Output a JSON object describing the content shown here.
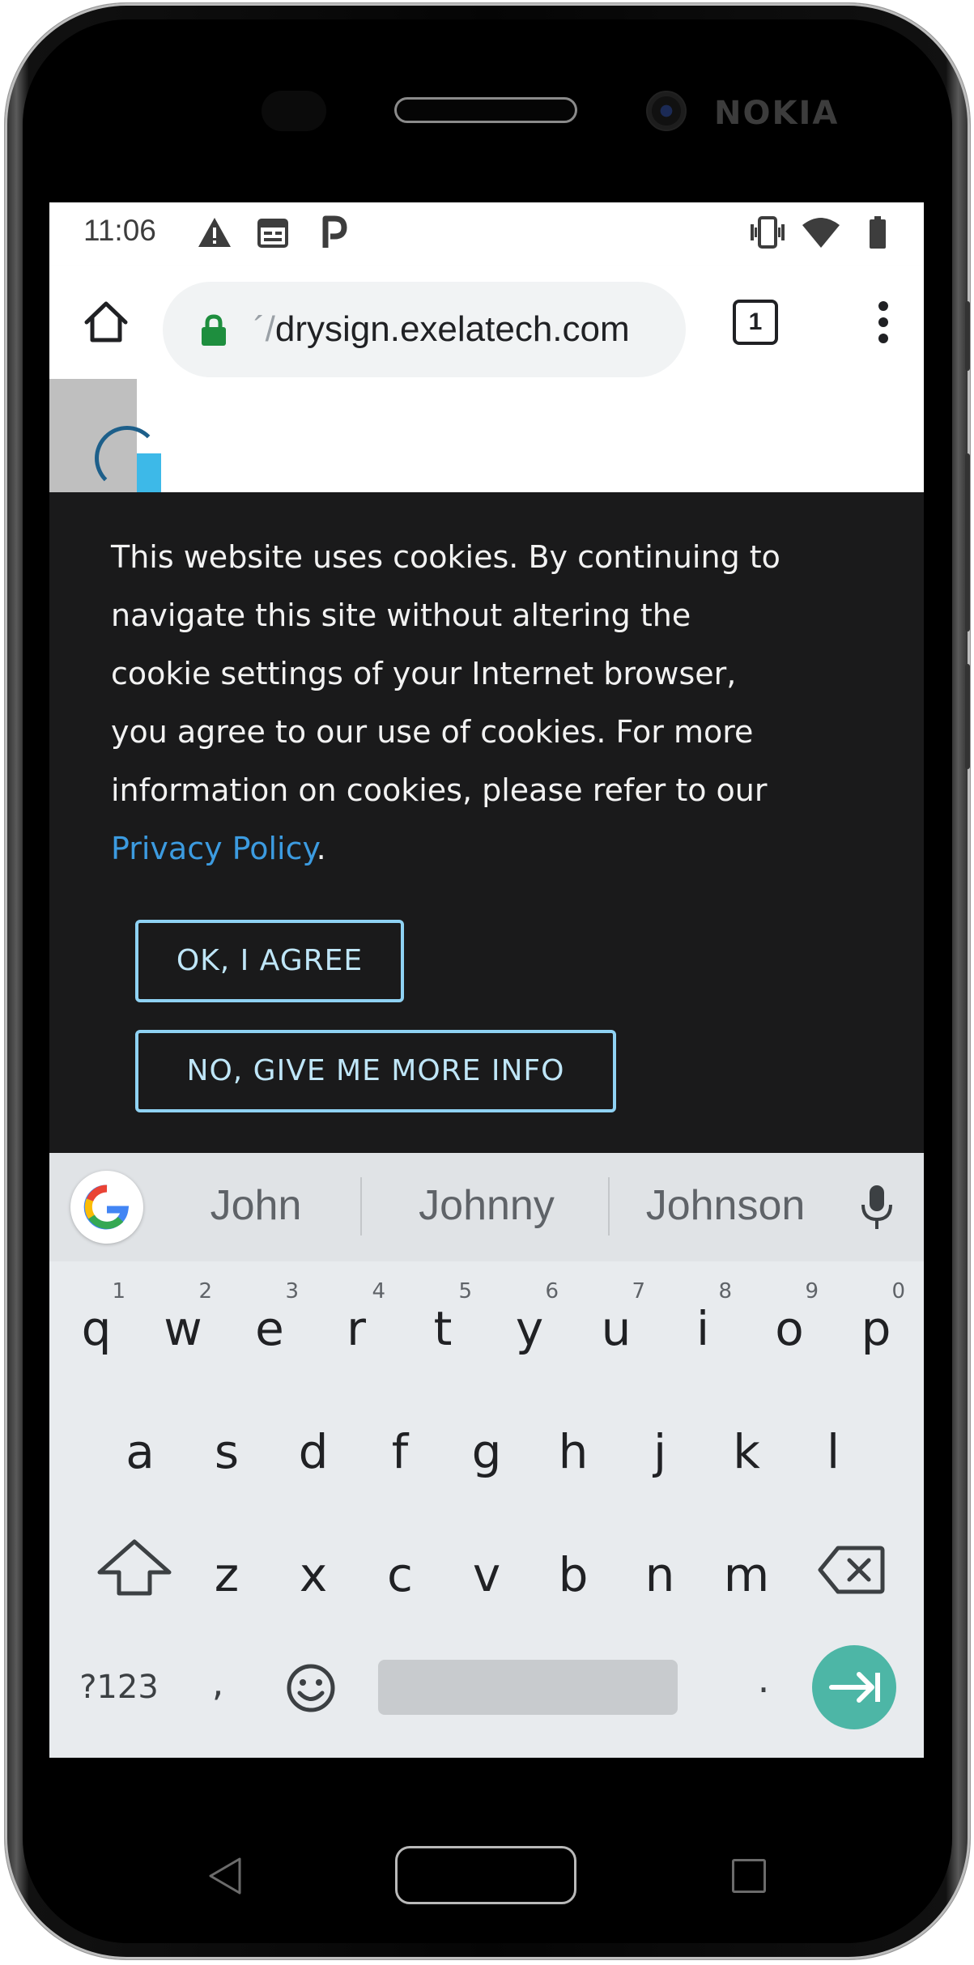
{
  "device": {
    "brand": "NOKIA"
  },
  "status_bar": {
    "time": "11:06",
    "left_icons": [
      "warning-icon",
      "calendar-icon",
      "parking-icon"
    ],
    "right_icons": [
      "vibrate-icon",
      "wifi-icon",
      "battery-icon"
    ]
  },
  "browser": {
    "url_scheme": "´/",
    "url_host": "drysign.exelatech.com",
    "tab_count": "1",
    "secure": true,
    "lock_color": "#1e8e3e"
  },
  "cookie_banner": {
    "lines": [
      "This website uses cookies. By continuing to",
      "navigate this site without altering the",
      "cookie settings of your Internet browser,",
      "you agree to our use of cookies. For more",
      "information on cookies, please refer to our"
    ],
    "link_text": "Privacy Policy",
    "after_link": ".",
    "agree_label": "OK, I AGREE",
    "more_info_label": "NO, GIVE ME MORE INFO",
    "accent_color": "#8fd2f3",
    "link_color": "#3c9be0",
    "background": "#1a1a1b"
  },
  "keyboard": {
    "suggestions": [
      "John",
      "Johnny",
      "Johnson"
    ],
    "row1": [
      {
        "k": "q",
        "h": "1"
      },
      {
        "k": "w",
        "h": "2"
      },
      {
        "k": "e",
        "h": "3"
      },
      {
        "k": "r",
        "h": "4"
      },
      {
        "k": "t",
        "h": "5"
      },
      {
        "k": "y",
        "h": "6"
      },
      {
        "k": "u",
        "h": "7"
      },
      {
        "k": "i",
        "h": "8"
      },
      {
        "k": "o",
        "h": "9"
      },
      {
        "k": "p",
        "h": "0"
      }
    ],
    "row2": [
      "a",
      "s",
      "d",
      "f",
      "g",
      "h",
      "j",
      "k",
      "l"
    ],
    "row3": [
      "z",
      "x",
      "c",
      "v",
      "b",
      "n",
      "m"
    ],
    "symbols_label": "?123",
    "comma_label": ",",
    "period_label": ".",
    "enter_color": "#4db6a6"
  }
}
